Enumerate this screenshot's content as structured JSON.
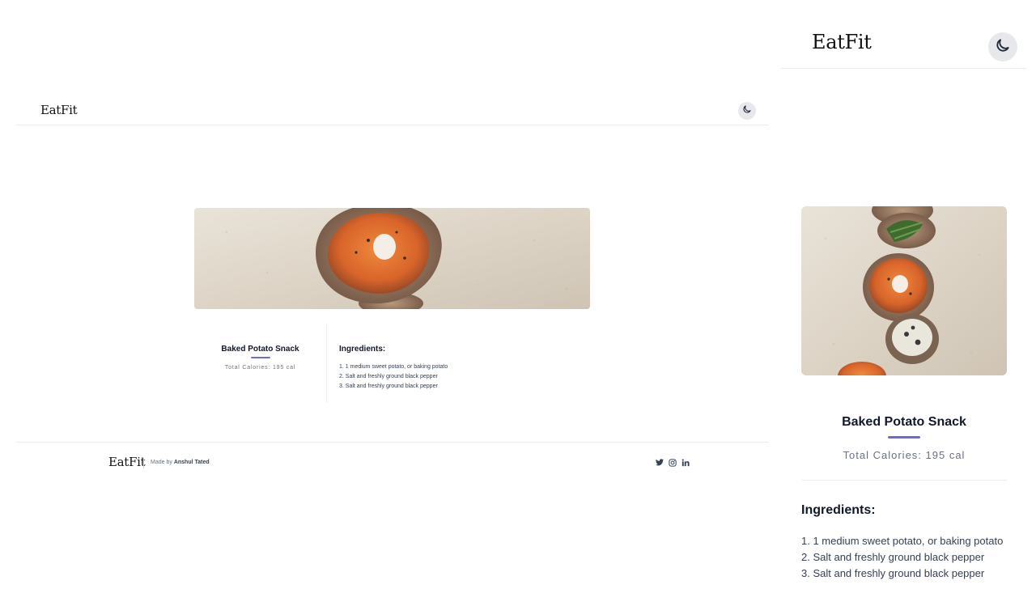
{
  "brand": "EatFit",
  "theme_toggle": {
    "icon": "moon-icon"
  },
  "recipe": {
    "title": "Baked Potato Snack",
    "calories": "Total Calories: 195 cal",
    "ingredients_title": "Ingredients:",
    "ingredients": [
      "1. 1 medium sweet potato, or baking potato",
      "2. Salt and freshly ground black pepper",
      "3. Salt and freshly ground black pepper"
    ],
    "image": "baked-potato-photo"
  },
  "footer": {
    "made_by_prefix": "Made by",
    "author": "Anshul Tated",
    "social": [
      "twitter-icon",
      "instagram-icon",
      "linkedin-icon"
    ]
  },
  "colors": {
    "accent": "#6b6bd6",
    "border": "#eceef1",
    "toggle_bg": "#e7e8ec",
    "muted_text": "#6b7280"
  }
}
